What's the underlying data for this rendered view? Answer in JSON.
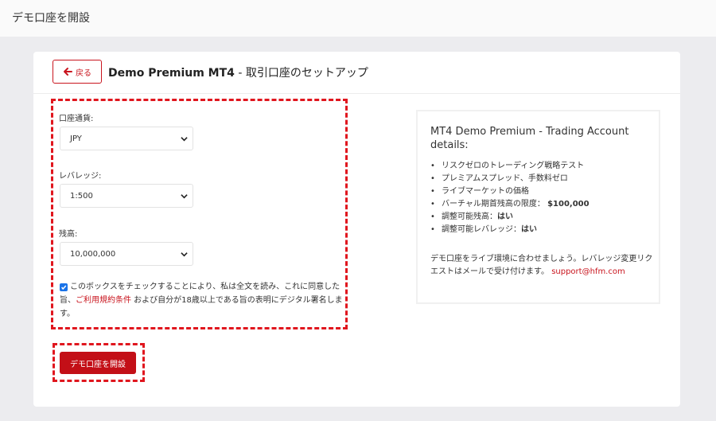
{
  "page": {
    "title": "デモ口座を開設"
  },
  "header": {
    "back_label": "戻る",
    "title_bold": "Demo Premium MT4",
    "title_rest": " - 取引口座のセットアップ"
  },
  "form": {
    "currency": {
      "label": "口座通貨:",
      "value": "JPY"
    },
    "leverage": {
      "label": "レバレッジ:",
      "value": "1:500"
    },
    "balance": {
      "label": "残高:",
      "value": "10,000,000"
    },
    "consent": {
      "checked": true,
      "text_before": "このボックスをチェックすることにより、私は全文を読み、これに同意した旨、",
      "link": "ご利用規約条件",
      "text_after": " および自分が18歳以上である旨の表明にデジタル署名します。"
    },
    "submit_label": "デモ口座を開設"
  },
  "info": {
    "title": "MT4 Demo Premium - Trading Account details:",
    "items": [
      {
        "text": "リスクゼロのトレーディング戦略テスト",
        "strong": ""
      },
      {
        "text": "プレミアムスプレッド、手数料ゼロ",
        "strong": ""
      },
      {
        "text": "ライブマーケットの価格",
        "strong": ""
      },
      {
        "text": "バーチャル期首残高の限度：",
        "strong": "$100,000"
      },
      {
        "text": "調整可能残高：",
        "strong": "はい"
      },
      {
        "text": "調整可能レバレッジ：",
        "strong": "はい"
      }
    ],
    "note": "デモ口座をライブ環境に合わせましょう。レバレッジ変更リクエストはメールで受け付けます。",
    "email": "support@hfm.com"
  },
  "colors": {
    "accent": "#c9151e",
    "highlight": "#e0161e",
    "checkbox": "#1a73e8"
  },
  "icons": {
    "back": "arrow-left-icon",
    "select": "chevron-down-icon",
    "check": "check-icon"
  }
}
